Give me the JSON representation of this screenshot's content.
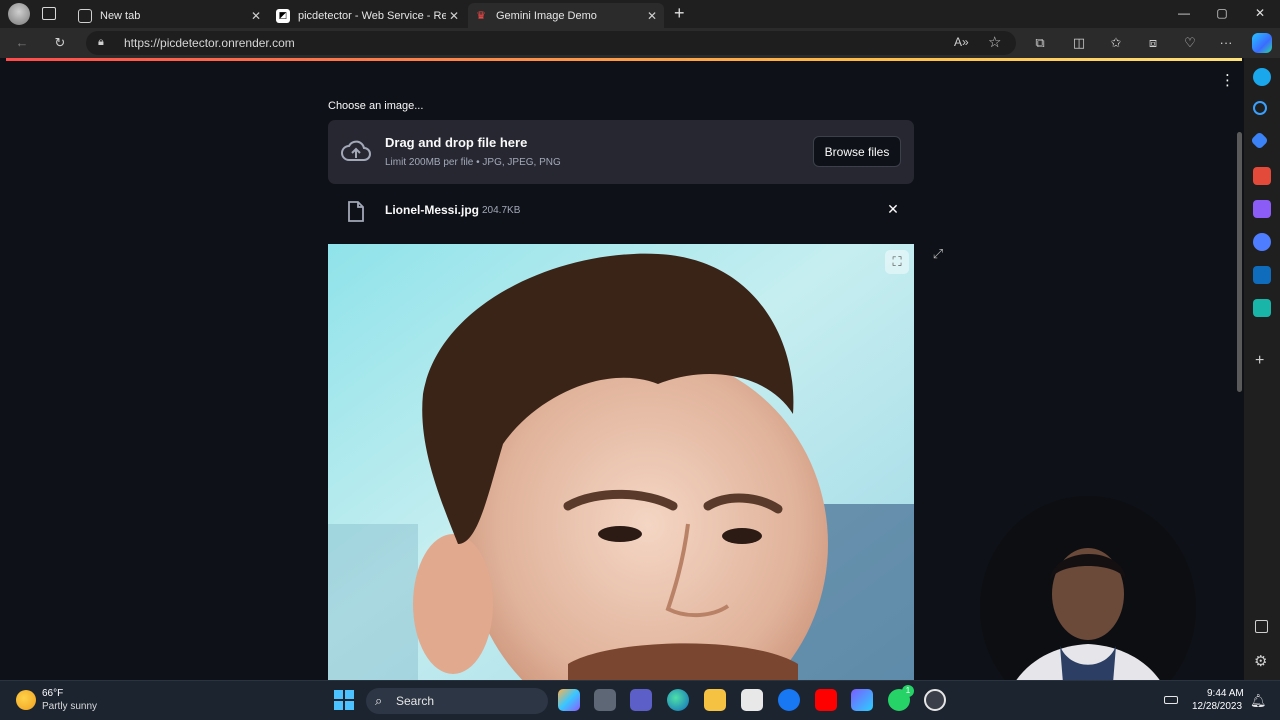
{
  "browser": {
    "tabs": [
      {
        "label": "New tab",
        "active": false
      },
      {
        "label": "picdetector - Web Service - Ren",
        "active": false
      },
      {
        "label": "Gemini Image Demo",
        "active": true
      }
    ],
    "new_tab_symbol": "+",
    "url": "https://picdetector.onrender.com",
    "window_controls": [
      "minimize-icon",
      "maximize-icon",
      "close-icon"
    ]
  },
  "app": {
    "uploader_label": "Choose an image...",
    "dropzone_title": "Drag and drop file here",
    "dropzone_subtitle": "Limit 200MB per file • JPG, JPEG, PNG",
    "browse_button": "Browse files",
    "file": {
      "name": "Lionel-Messi.jpg",
      "size": "204.7KB"
    },
    "accent_colors": [
      "#ff4b4b",
      "#ffbd45"
    ]
  },
  "taskbar": {
    "weather_temp": "66°F",
    "weather_desc": "Partly sunny",
    "search_label": "Search",
    "time": "9:44 AM",
    "date": "12/28/2023",
    "whatsapp_badge": "1"
  }
}
